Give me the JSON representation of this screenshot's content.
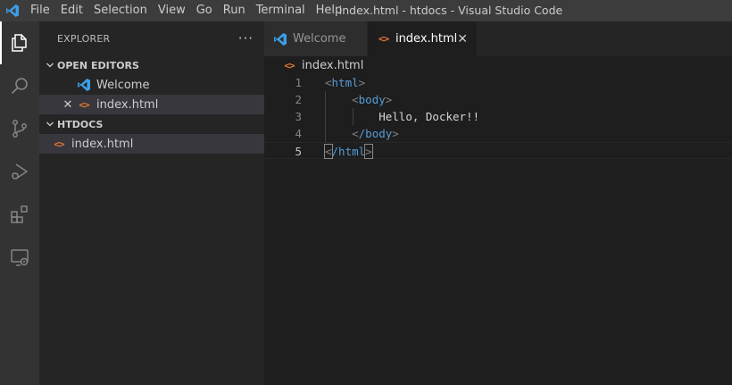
{
  "titlebar": {
    "menu": [
      "File",
      "Edit",
      "Selection",
      "View",
      "Go",
      "Run",
      "Terminal",
      "Help"
    ],
    "window_title": "index.html - htdocs - Visual Studio Code"
  },
  "activitybar": {
    "items": [
      "explorer-icon",
      "search-icon",
      "source-control-icon",
      "run-debug-icon",
      "extensions-icon",
      "remote-explorer-icon"
    ]
  },
  "sidebar": {
    "title": "EXPLORER",
    "more": "···",
    "open_editors": {
      "label": "OPEN EDITORS",
      "items": [
        {
          "label": "Welcome",
          "icon": "vscode-icon"
        },
        {
          "label": "index.html",
          "icon": "html-file-icon"
        }
      ]
    },
    "folder": {
      "label": "HTDOCS",
      "items": [
        {
          "label": "index.html",
          "icon": "html-file-icon"
        }
      ]
    }
  },
  "editor": {
    "tabs": [
      {
        "label": "Welcome",
        "active": false
      },
      {
        "label": "index.html",
        "active": true
      }
    ],
    "breadcrumb": "index.html",
    "lines": [
      {
        "num": "1"
      },
      {
        "num": "2"
      },
      {
        "num": "3"
      },
      {
        "num": "4"
      },
      {
        "num": "5"
      }
    ],
    "code": {
      "html_open": "html",
      "body_open": "body",
      "text": "Hello, Docker!!",
      "body_close": "/body",
      "html_close": "/html"
    }
  },
  "colors": {
    "accent": "#007acc",
    "html_icon": "#e37933",
    "tag": "#569cd6"
  }
}
